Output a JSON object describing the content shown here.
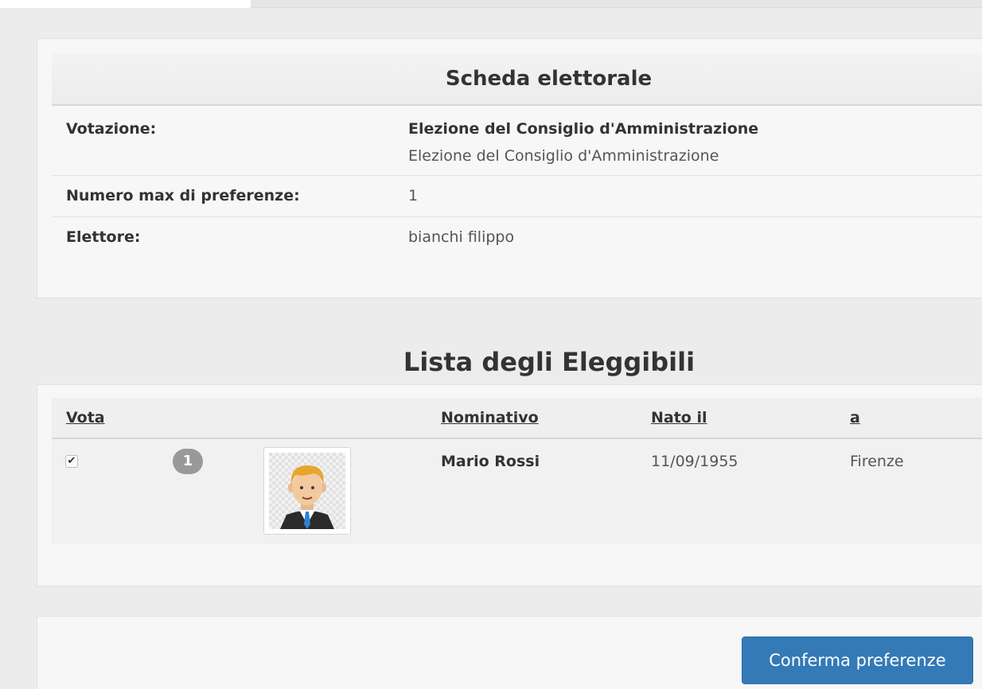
{
  "ballot": {
    "title": "Scheda elettorale",
    "rows": {
      "votazione": {
        "label": "Votazione:",
        "value_title": "Elezione del Consiglio d'Amministrazione",
        "value_desc": "Elezione del Consiglio d'Amministrazione"
      },
      "max_preferenze": {
        "label": "Numero max di preferenze:",
        "value": "1"
      },
      "elettore": {
        "label": "Elettore:",
        "value": "bianchi filippo"
      }
    }
  },
  "candidates": {
    "heading": "Lista degli Eleggibili",
    "columns": {
      "vota": "Vota",
      "nominativo": "Nominativo",
      "nato_il": "Nato il",
      "a": "a"
    },
    "rows": [
      {
        "checked": true,
        "number": "1",
        "photo_icon": "avatar-man-icon",
        "nominativo": "Mario Rossi",
        "nato_il": "11/09/1955",
        "a": "Firenze"
      }
    ]
  },
  "footer": {
    "confirm_label": "Conferma preferenze"
  },
  "colors": {
    "accent": "#337ab7",
    "badge": "#999999",
    "background": "#ececec"
  }
}
